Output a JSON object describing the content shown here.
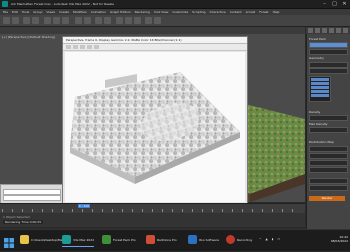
{
  "window": {
    "title": "Ark Manhattan Forest.max - Autodesk 3ds Max 2022 - Not for Resale",
    "controls": [
      "–",
      "□",
      "✕"
    ]
  },
  "menu": [
    "File",
    "Edit",
    "Tools",
    "Group",
    "Views",
    "Create",
    "Modifiers",
    "Animation",
    "Graph Editors",
    "Rendering",
    "Civil View",
    "Customize",
    "Scripting",
    "Interactive",
    "Content",
    "Arnold",
    "Forest",
    "Help"
  ],
  "ribbon": [
    "Modeling",
    "Freeform",
    "Selection",
    "Object Paint",
    "Populate"
  ],
  "viewport": {
    "label": "[+] [Perspective] [Default Shading]"
  },
  "render_window": {
    "title": "Perspective, frame 0, Display Gamma: 2.2, RGBA Color 16 Bits/Channel (1:1)"
  },
  "left_panel": {
    "button": "OK"
  },
  "command_panel": {
    "title": "Forest Pack",
    "section": "Geometry",
    "field1": "Density",
    "field2": "Max Density",
    "rollout": "Distribution Map",
    "button": "Render"
  },
  "timeline": {
    "frame": "0 / 100"
  },
  "status": {
    "line1": "1 Object Selected",
    "line2": "Rendering Time 0:00:05"
  },
  "taskbar": {
    "items": [
      {
        "label": "C:\\Users\\Desktop\\Max",
        "color": "#e8c34a"
      },
      {
        "label": "3ds Max 2022",
        "color": "#1c9c97"
      },
      {
        "label": "Forest Pack Pro",
        "color": "#3f8f3a"
      },
      {
        "label": "RailClone Pro",
        "color": "#d24d35"
      },
      {
        "label": "Itoo Software",
        "color": "#2d6fc2"
      },
      {
        "label": "Recording",
        "color": "#c0392b"
      }
    ],
    "clock": "10:42",
    "date": "08/03/2022"
  },
  "colors": {
    "accent": "#5b8fd6",
    "highlight": "#c96a1b",
    "terrain_green": "#5f8f3e",
    "terrain_brown": "#8a6a48"
  }
}
